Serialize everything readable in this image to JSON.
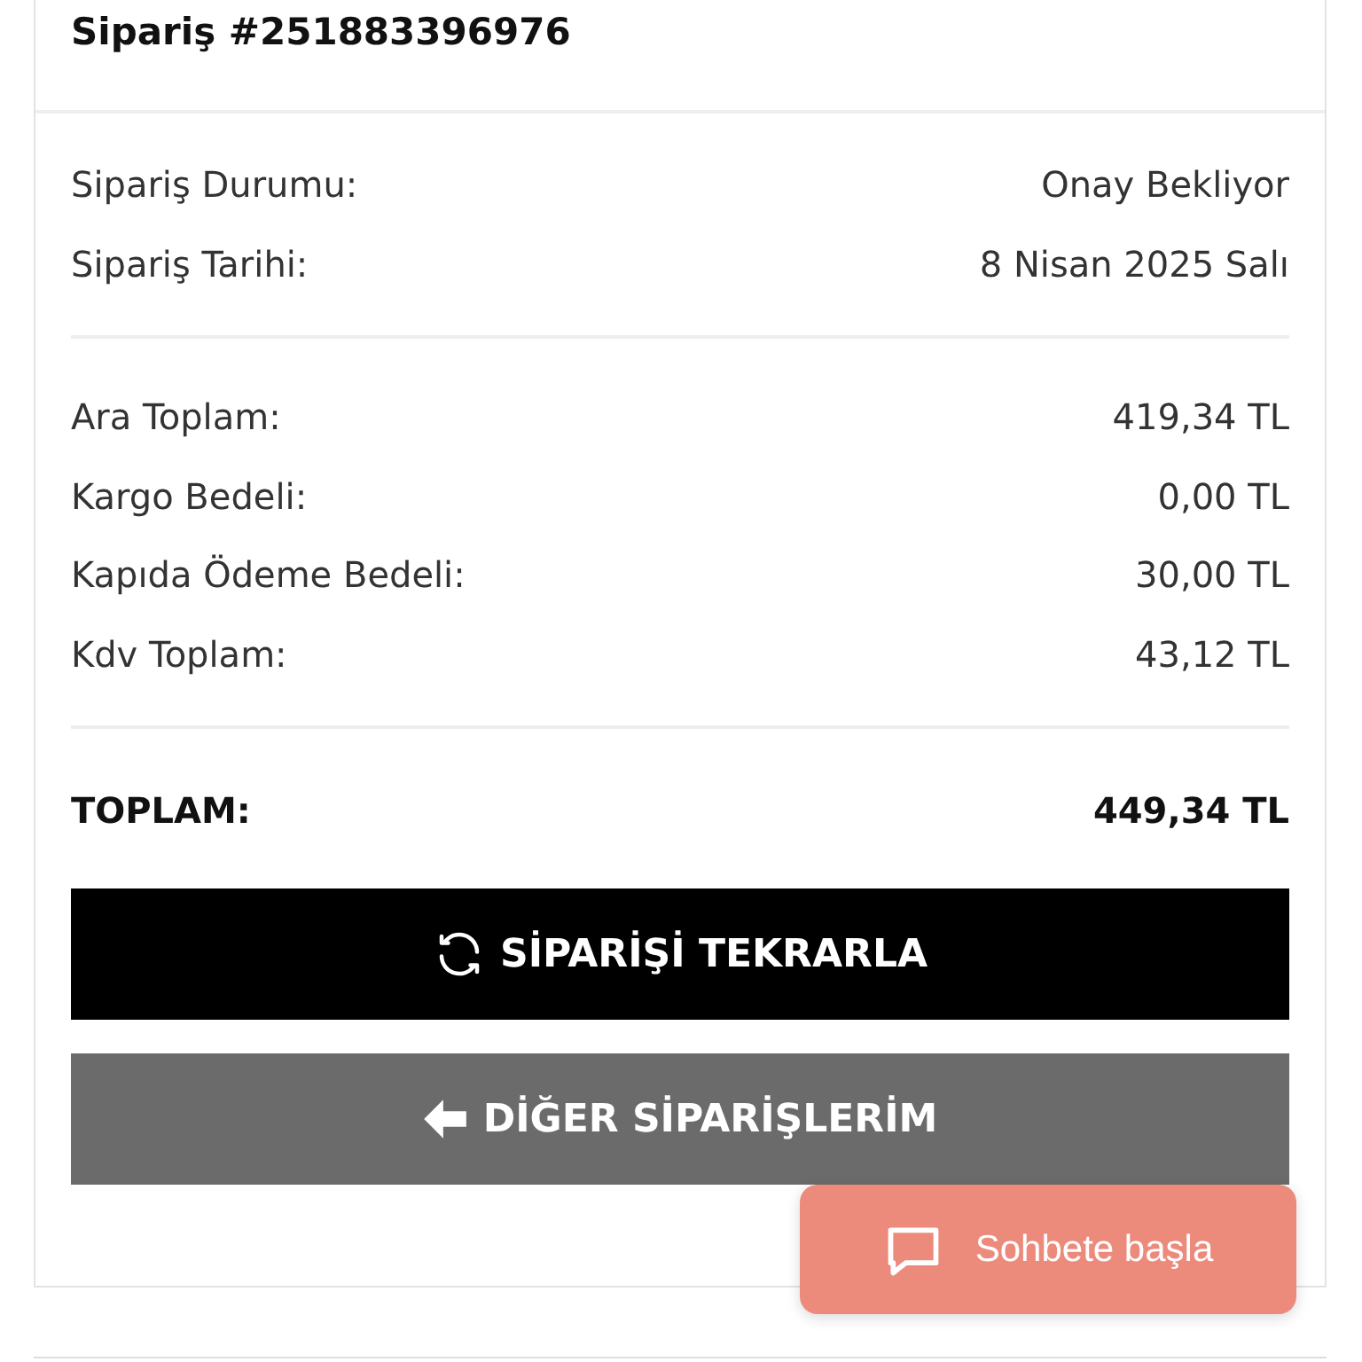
{
  "order": {
    "title": "Sipariş #251883396976"
  },
  "info_rows": [
    {
      "label": "Sipariş Durumu:",
      "value": "Onay Bekliyor"
    },
    {
      "label": "Sipariş Tarihi:",
      "value": "8 Nisan 2025 Salı"
    }
  ],
  "cost_rows": [
    {
      "label": "Ara Toplam:",
      "value": "419,34 TL"
    },
    {
      "label": "Kargo Bedeli:",
      "value": "0,00 TL"
    },
    {
      "label": "Kapıda Ödeme Bedeli:",
      "value": "30,00 TL"
    },
    {
      "label": "Kdv Toplam:",
      "value": "43,12 TL"
    }
  ],
  "total": {
    "label": "TOPLAM:",
    "value": "449,34 TL"
  },
  "buttons": [
    {
      "kind": "reorder",
      "label": "SİPARİŞİ TEKRARLA"
    },
    {
      "kind": "back",
      "label": "DİĞER SİPARİŞLERİM"
    }
  ],
  "chat": {
    "label": "Sohbete başla"
  }
}
